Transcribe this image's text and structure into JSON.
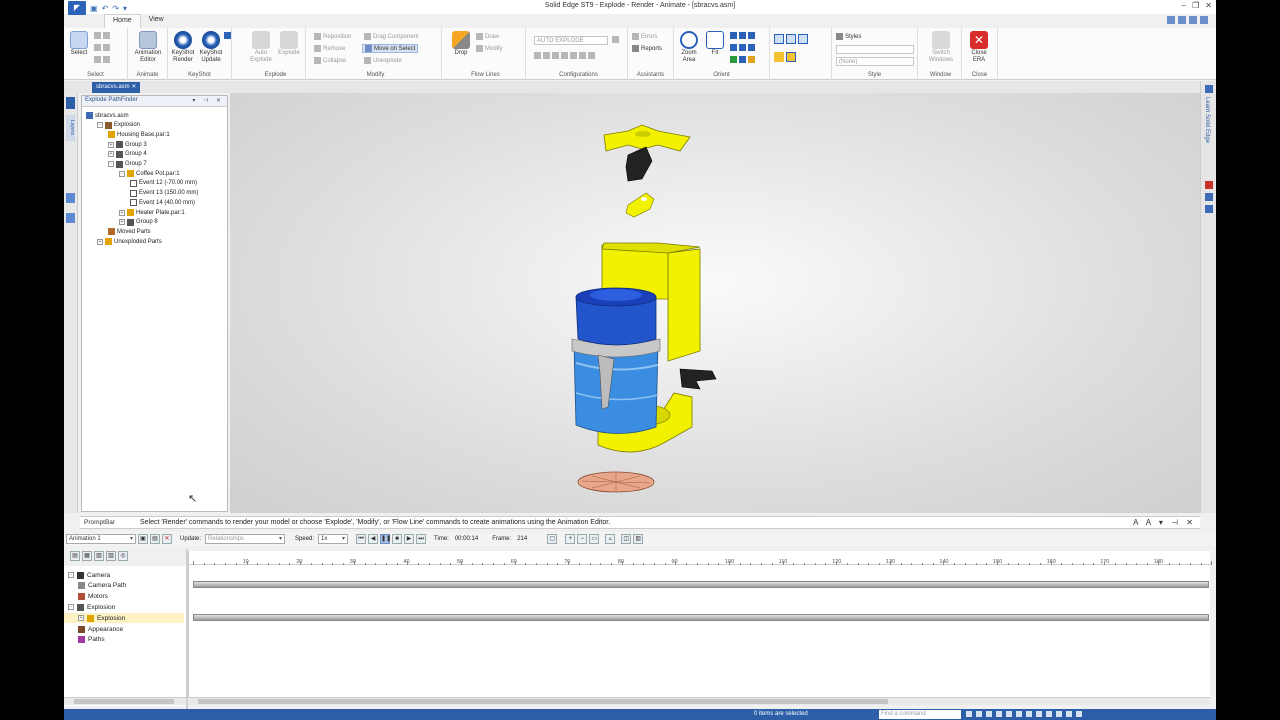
{
  "window": {
    "title": "Solid Edge ST9 - Explode - Render - Animate - [sbracvs.asm]"
  },
  "ribbon_tabs": [
    {
      "label": "Home",
      "active": true
    },
    {
      "label": "View",
      "active": false
    }
  ],
  "ribbon": {
    "groups": {
      "select": "Select",
      "animate": "Animate",
      "keyshot": "KeyShot",
      "explode": "Explode",
      "modify": "Modify",
      "flow_lines": "Flow Lines",
      "configurations": "Configurations",
      "assistants": "Assistants",
      "orient": "Orient",
      "style": "Style",
      "window": "Window",
      "close": "Close"
    },
    "buttons": {
      "select": "Select",
      "animation_editor": "Animation Editor",
      "keyshot_render": "KeyShot Render",
      "keyshot_update": "KeyShot Update",
      "auto_explode": "Auto Explode",
      "explode": "Explode",
      "reposition": "Reposition",
      "remove": "Remove",
      "collapse": "Collapse",
      "drag_component": "Drag Component",
      "move_on_select": "Move on Select",
      "unexplode": "Unexplode",
      "drop": "Drop",
      "draw": "Draw",
      "modify": "Modify",
      "errors": "Errors",
      "reports": "Reports",
      "zoom_area": "Zoom Area",
      "fit": "Fit",
      "styles": "Styles",
      "style_value": "(None)",
      "switch_windows": "Switch Windows",
      "close_era": "Close ERA"
    },
    "configuration_select": "AUTO EXPLODE"
  },
  "document_tab": "sbracvs.asm",
  "left_tabs": [
    "Layers"
  ],
  "pathfinder": {
    "title": "Explode PathFinder",
    "tree": [
      {
        "label": "sbracvs.asm",
        "level": 0,
        "expand": ""
      },
      {
        "label": "Explosion",
        "level": 1,
        "expand": "-"
      },
      {
        "label": "Housing Base.par:1",
        "level": 2,
        "expand": ""
      },
      {
        "label": "Group 3",
        "level": 2,
        "expand": "+"
      },
      {
        "label": "Group 4",
        "level": 2,
        "expand": "+"
      },
      {
        "label": "Group 7",
        "level": 2,
        "expand": "-"
      },
      {
        "label": "Coffee Pot.par:1",
        "level": 3,
        "expand": "-"
      },
      {
        "label": "Event 12  (-70.00 mm)",
        "level": 4,
        "expand": ""
      },
      {
        "label": "Event 13  (150.00 mm)",
        "level": 4,
        "expand": ""
      },
      {
        "label": "Event 14  (40.00 mm)",
        "level": 4,
        "expand": ""
      },
      {
        "label": "Heater Plate.par:1",
        "level": 3,
        "expand": "+"
      },
      {
        "label": "Group 8",
        "level": 3,
        "expand": "+"
      },
      {
        "label": "Moved Parts",
        "level": 2,
        "expand": ""
      },
      {
        "label": "Unexploded Parts",
        "level": 1,
        "expand": "+"
      }
    ]
  },
  "right_panel": {
    "label": "Learn Solid Edge"
  },
  "promptbar": {
    "label": "PromptBar",
    "message": "Select 'Render' commands to render your model or choose 'Explode', 'Modify', or 'Flow Line' commands to create animations using the Animation Editor."
  },
  "animation": {
    "name": "Animation 1",
    "update_label": "Update:",
    "update_value": "Relationships",
    "speed_label": "Speed:",
    "speed_value": "1x",
    "time_label": "Time:",
    "time_value": "00:00:14",
    "frame_label": "Frame:",
    "frame_value": "214",
    "tree": [
      {
        "label": "Camera",
        "level": 0,
        "expand": "-",
        "selected": false
      },
      {
        "label": "Camera Path",
        "level": 1,
        "expand": "",
        "selected": false
      },
      {
        "label": "Motors",
        "level": 1,
        "expand": "",
        "selected": false
      },
      {
        "label": "Explosion",
        "level": 0,
        "expand": "-",
        "selected": false
      },
      {
        "label": "Explosion",
        "level": 1,
        "expand": "+",
        "selected": true
      },
      {
        "label": "Appearance",
        "level": 1,
        "expand": "",
        "selected": false
      },
      {
        "label": "Paths",
        "level": 1,
        "expand": "",
        "selected": false
      }
    ],
    "ruler_ticks": [
      "10",
      "20",
      "30",
      "40",
      "50",
      "60",
      "70",
      "80",
      "90",
      "100",
      "110",
      "120",
      "130",
      "140",
      "150",
      "160",
      "170",
      "180"
    ]
  },
  "status": {
    "message": "0 items are selected",
    "find_placeholder": "Find a command"
  },
  "colors": {
    "accent": "#2c5fa8",
    "yellow_part": "#f2f200",
    "blue_part": "#2255cc",
    "light_blue_part": "#3a8de0",
    "close_red": "#d82b2b"
  }
}
